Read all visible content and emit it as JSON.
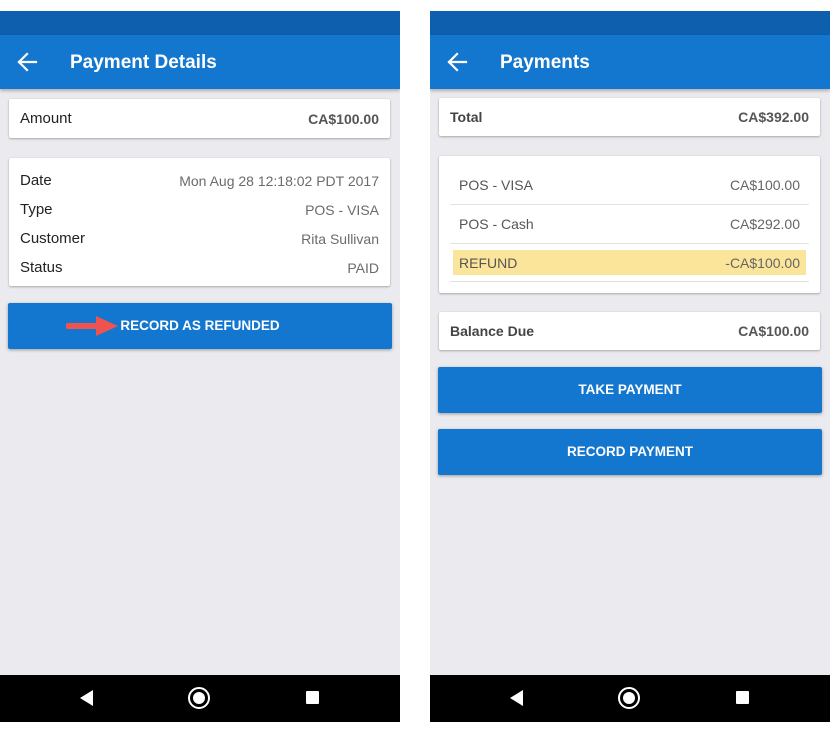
{
  "left": {
    "title": "Payment Details",
    "amount": {
      "label": "Amount",
      "value": "CA$100.00"
    },
    "details": [
      {
        "label": "Date",
        "value": "Mon Aug 28 12:18:02 PDT 2017"
      },
      {
        "label": "Type",
        "value": "POS - VISA"
      },
      {
        "label": "Customer",
        "value": "Rita Sullivan"
      },
      {
        "label": "Status",
        "value": "PAID"
      }
    ],
    "refund_button": "RECORD AS REFUNDED"
  },
  "right": {
    "title": "Payments",
    "total": {
      "label": "Total",
      "value": "CA$392.00"
    },
    "payments": [
      {
        "label": "POS - VISA",
        "value": "CA$100.00"
      },
      {
        "label": "POS - Cash",
        "value": "CA$292.00"
      },
      {
        "label": "REFUND",
        "value": "-CA$100.00"
      }
    ],
    "balance": {
      "label": "Balance Due",
      "value": "CA$100.00"
    },
    "take_payment_button": "TAKE PAYMENT",
    "record_payment_button": "RECORD PAYMENT"
  },
  "colors": {
    "primary": "#1477cf",
    "status_bar": "#0e5fad",
    "background": "#ebebef",
    "refund_highlight": "#fbe59a",
    "annotation_arrow": "#ef5350"
  },
  "icons": [
    "arrow-back-icon",
    "nav-back-icon",
    "nav-home-icon",
    "nav-recents-icon",
    "annotation-arrow-icon"
  ]
}
